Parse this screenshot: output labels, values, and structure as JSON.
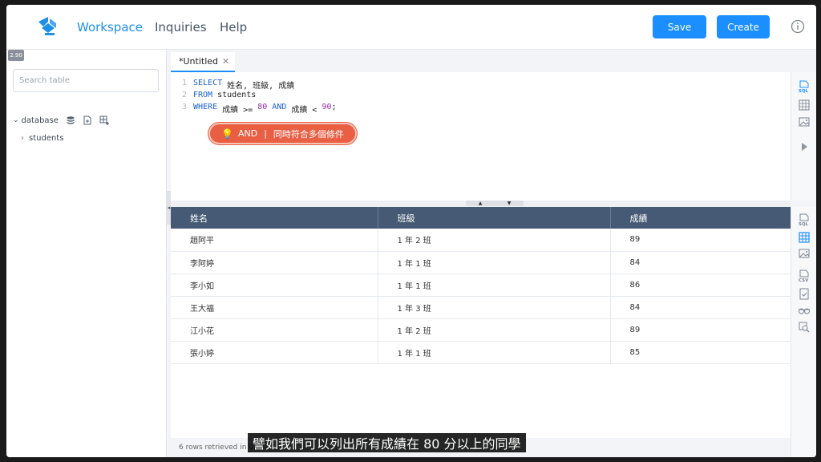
{
  "nav": {
    "items": [
      "Workspace",
      "Inquiries",
      "Help"
    ],
    "save_label": "Save",
    "create_label": "Create",
    "accent": "#1b8fff"
  },
  "sidebar": {
    "version": "2.90",
    "search_placeholder": "Search table",
    "tree": {
      "root": "database",
      "children": [
        "students"
      ]
    }
  },
  "editor": {
    "tab_title": "*Untitled",
    "line_numbers": [
      "1",
      "2",
      "3"
    ],
    "lines": [
      [
        {
          "t": "SELECT",
          "c": "kw"
        },
        {
          "t": " 姓名, 班級, 成績",
          "c": "txt"
        }
      ],
      [
        {
          "t": "FROM",
          "c": "kw"
        },
        {
          "t": " students",
          "c": "txt"
        }
      ],
      [
        {
          "t": "WHERE",
          "c": "kw"
        },
        {
          "t": " 成績 >= ",
          "c": "txt"
        },
        {
          "t": "80",
          "c": "num"
        },
        {
          "t": " ",
          "c": "txt"
        },
        {
          "t": "AND",
          "c": "kw"
        },
        {
          "t": " 成績 < ",
          "c": "txt"
        },
        {
          "t": "90",
          "c": "num"
        },
        {
          "t": ";",
          "c": "txt"
        }
      ]
    ],
    "hint": {
      "keyword": "AND",
      "separator": "|",
      "text": "同時符合多個條件"
    }
  },
  "results": {
    "columns": [
      "姓名",
      "班級",
      "成績"
    ],
    "rows": [
      [
        "趙阿平",
        "1 年 2 班",
        "89"
      ],
      [
        "李阿婷",
        "1 年 1 班",
        "84"
      ],
      [
        "李小如",
        "1 年 1 班",
        "86"
      ],
      [
        "王大福",
        "1 年 3 班",
        "84"
      ],
      [
        "江小花",
        "1 年 2 班",
        "89"
      ],
      [
        "張小婷",
        "1 年 1 班",
        "85"
      ]
    ],
    "status": "6 rows retrieved in 0."
  },
  "subtitle": "譬如我們可以列出所有成績在 80 分以上的同學"
}
